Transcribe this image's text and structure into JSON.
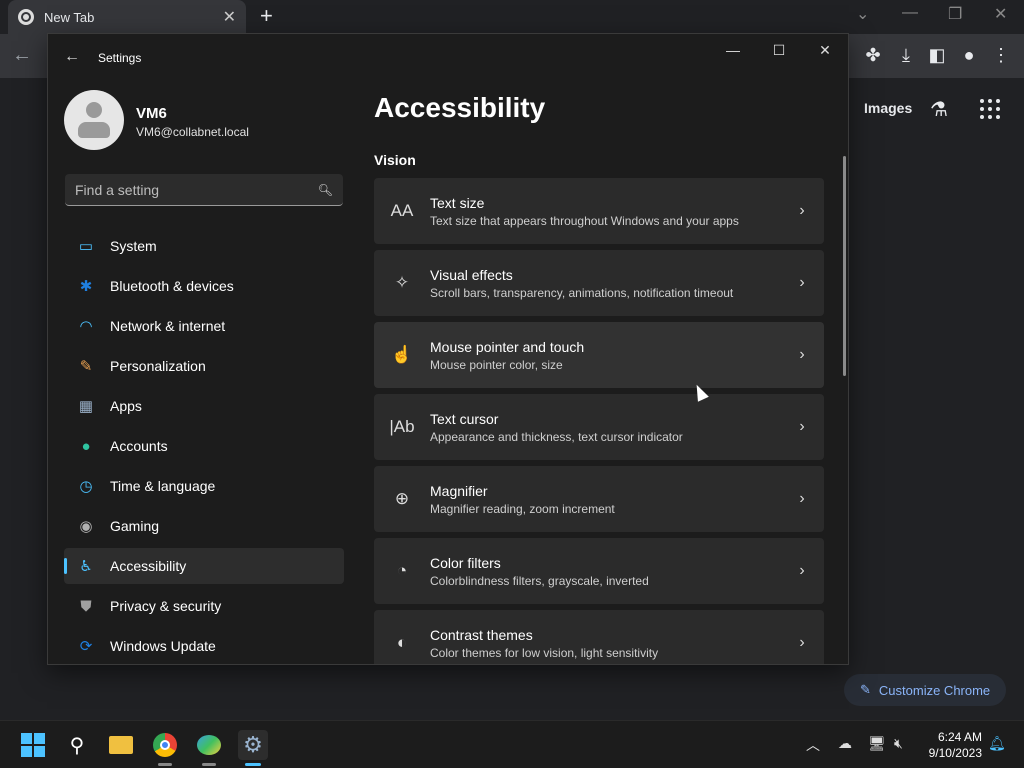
{
  "chrome": {
    "tab_title": "New Tab",
    "new_tab_symbol": "+",
    "images_link": "Images",
    "customize_label": "Customize Chrome"
  },
  "settings": {
    "window_title": "Settings",
    "user": {
      "name": "VM6",
      "email": "VM6@collabnet.local"
    },
    "search_placeholder": "Find a setting",
    "nav": [
      {
        "label": "System",
        "icon": "system-icon",
        "color": "#4cc2ff"
      },
      {
        "label": "Bluetooth & devices",
        "icon": "bluetooth-icon",
        "color": "#1f7fe0"
      },
      {
        "label": "Network & internet",
        "icon": "wifi-icon",
        "color": "#4cc2ff"
      },
      {
        "label": "Personalization",
        "icon": "brush-icon",
        "color": "#e8a050"
      },
      {
        "label": "Apps",
        "icon": "apps-icon",
        "color": "#9ab0c8"
      },
      {
        "label": "Accounts",
        "icon": "person-icon",
        "color": "#2fc4a0"
      },
      {
        "label": "Time & language",
        "icon": "globe-clock-icon",
        "color": "#4cc2ff"
      },
      {
        "label": "Gaming",
        "icon": "gamepad-icon",
        "color": "#b0b0b0"
      },
      {
        "label": "Accessibility",
        "icon": "accessibility-icon",
        "color": "#4cc2ff",
        "active": true
      },
      {
        "label": "Privacy & security",
        "icon": "shield-icon",
        "color": "#a0a0a0"
      },
      {
        "label": "Windows Update",
        "icon": "update-icon",
        "color": "#1f7fe0"
      }
    ],
    "page_title": "Accessibility",
    "section": "Vision",
    "cards": [
      {
        "title": "Text size",
        "subtitle": "Text size that appears throughout Windows and your apps",
        "icon": "text-size-icon",
        "glyph": "AA"
      },
      {
        "title": "Visual effects",
        "subtitle": "Scroll bars, transparency, animations, notification timeout",
        "icon": "visual-effects-icon",
        "glyph": "✧"
      },
      {
        "title": "Mouse pointer and touch",
        "subtitle": "Mouse pointer color, size",
        "icon": "mouse-pointer-icon",
        "glyph": "☝"
      },
      {
        "title": "Text cursor",
        "subtitle": "Appearance and thickness, text cursor indicator",
        "icon": "text-cursor-icon",
        "glyph": "|Ab"
      },
      {
        "title": "Magnifier",
        "subtitle": "Magnifier reading, zoom increment",
        "icon": "magnifier-icon",
        "glyph": "⊕"
      },
      {
        "title": "Color filters",
        "subtitle": "Colorblindness filters, grayscale, inverted",
        "icon": "palette-icon",
        "glyph": "◔"
      },
      {
        "title": "Contrast themes",
        "subtitle": "Color themes for low vision, light sensitivity",
        "icon": "contrast-icon",
        "glyph": "◐"
      }
    ]
  },
  "taskbar": {
    "time": "6:24 AM",
    "date": "9/10/2023"
  }
}
